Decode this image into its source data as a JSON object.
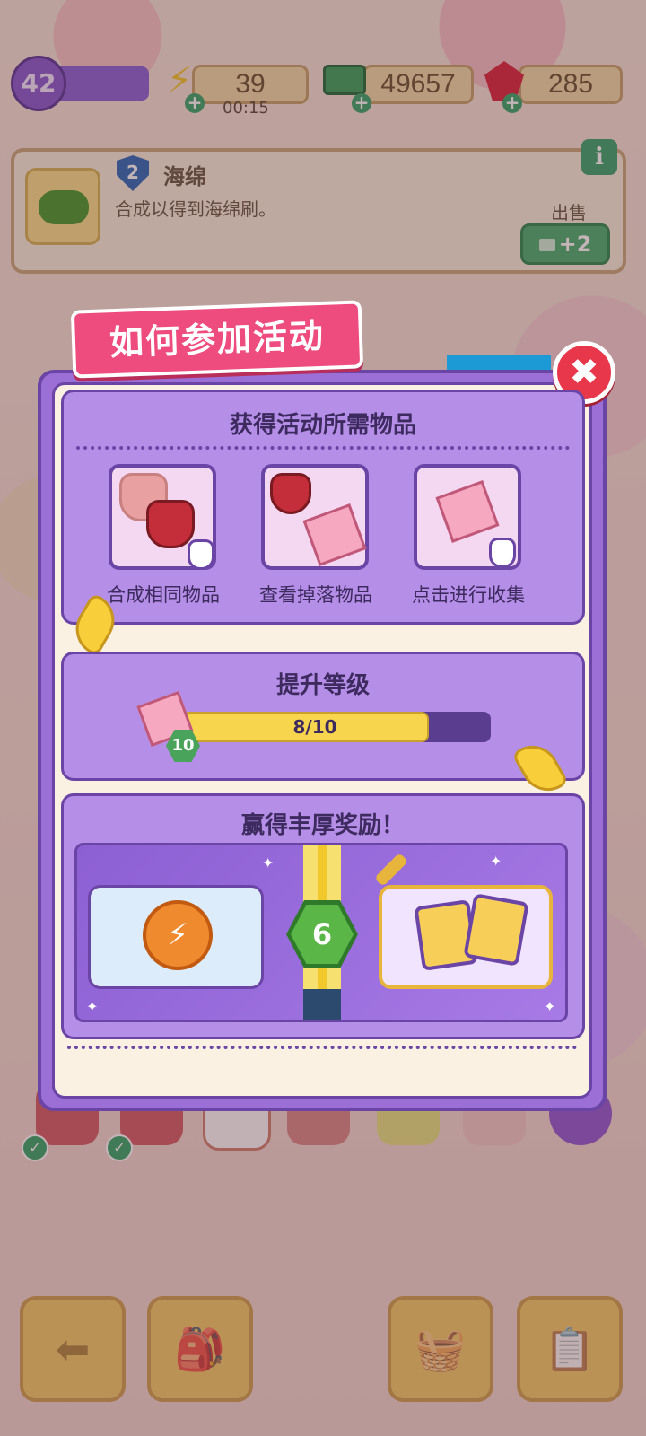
{
  "status": {
    "player_level": "42",
    "energy": "39",
    "energy_timer": "00:15",
    "cash": "49657",
    "gems": "285"
  },
  "item_info": {
    "level": "2",
    "name": "海绵",
    "description": "合成以得到海绵刷。",
    "info_icon": "i",
    "sell_label": "出售",
    "sell_value": "+2"
  },
  "modal": {
    "title": "如何参加活动",
    "close_icon": "✖",
    "section1": {
      "title": "获得活动所需物品",
      "steps": [
        {
          "label": "合成相同物品"
        },
        {
          "label": "查看掉落物品"
        },
        {
          "label": "点击进行收集"
        }
      ]
    },
    "section2": {
      "title": "提升等级",
      "item_level": "10",
      "progress_text": "8/10",
      "progress_fraction": 0.8
    },
    "section3": {
      "title": "赢得丰厚奖励！",
      "milestone": "6"
    }
  },
  "bottom_bar": {
    "back_icon": "⬅",
    "bag_icon": "backpack-icon",
    "basket_icon": "basket-icon",
    "tasks_icon": "clipboard-icon"
  }
}
